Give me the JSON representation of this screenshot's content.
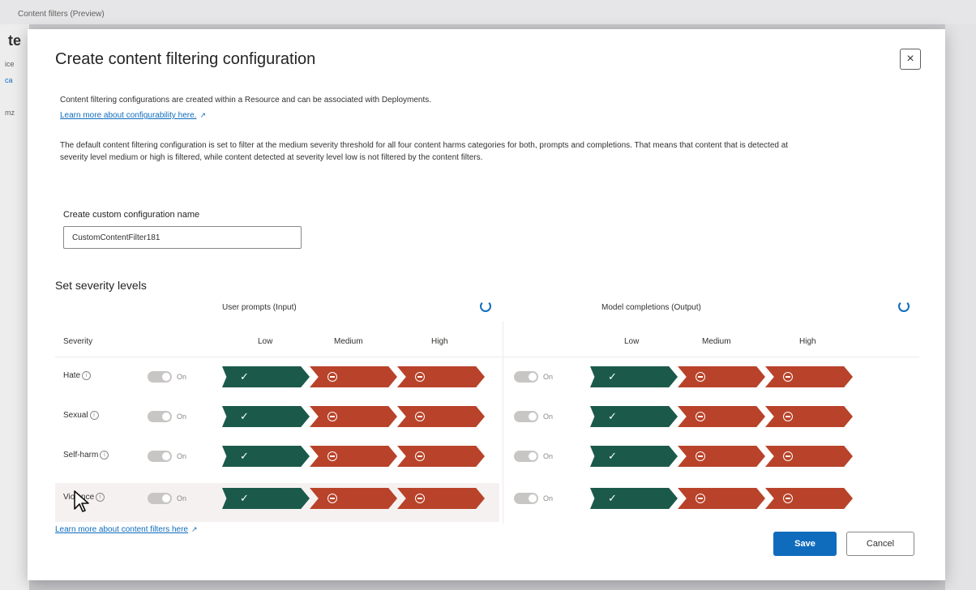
{
  "background": {
    "page_title": "Content filters (Preview)"
  },
  "dialog": {
    "title": "Create content filtering configuration",
    "close_label": "×",
    "intro": "Content filtering configurations are created within a Resource and can be associated with Deployments.",
    "config_link": "Learn more about configurability here.",
    "description": "The default content filtering configuration is set to filter at the medium severity threshold for all four content harms categories for both, prompts and completions. That means that content that is detected at severity level medium or high is filtered, while content detected at severity level low is not filtered by the content filters.",
    "name_label": "Create custom configuration name",
    "name_value": "CustomContentFilter181",
    "severity_title": "Set severity levels",
    "input_header": "User prompts (Input)",
    "output_header": "Model completions (Output)",
    "severity_col": "Severity",
    "levels": [
      "Low",
      "Medium",
      "High"
    ],
    "toggle_label": "On",
    "categories": [
      "Hate",
      "Sexual",
      "Self-harm",
      "Violence"
    ],
    "filters_link": "Learn more about content filters here",
    "save_label": "Save",
    "cancel_label": "Cancel"
  },
  "colors": {
    "allowed": "#1b5a4b",
    "filtered": "#b8432a",
    "primary": "#0f6cbd"
  },
  "icons": {
    "allowed": "checkmark-icon",
    "filtered": "block-icon",
    "reset": "refresh-icon",
    "info": "info-icon",
    "external": "external-link-icon"
  }
}
